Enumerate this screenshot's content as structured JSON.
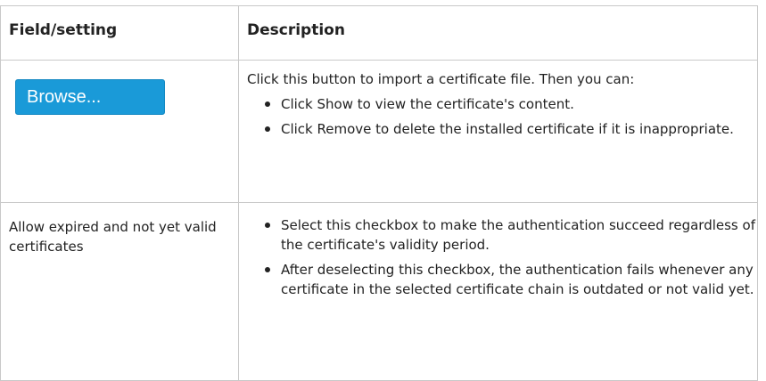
{
  "table": {
    "headers": {
      "field": "Field/setting",
      "description": "Description"
    },
    "rows": [
      {
        "field_button": "Browse...",
        "intro": "Click this button to import a certificate file. Then you can:",
        "bullets": [
          "Click Show to view the certificate's content.",
          "Click Remove to delete the installed certificate if it is inappropriate."
        ]
      },
      {
        "field": "Allow expired and not yet valid certificates",
        "bullets": [
          "Select this checkbox to make the authentication succeed regardless of the certificate's validity period.",
          "After deselecting this checkbox, the authentication fails whenever any certificate in the selected certificate chain is outdated or not valid yet."
        ]
      }
    ]
  }
}
